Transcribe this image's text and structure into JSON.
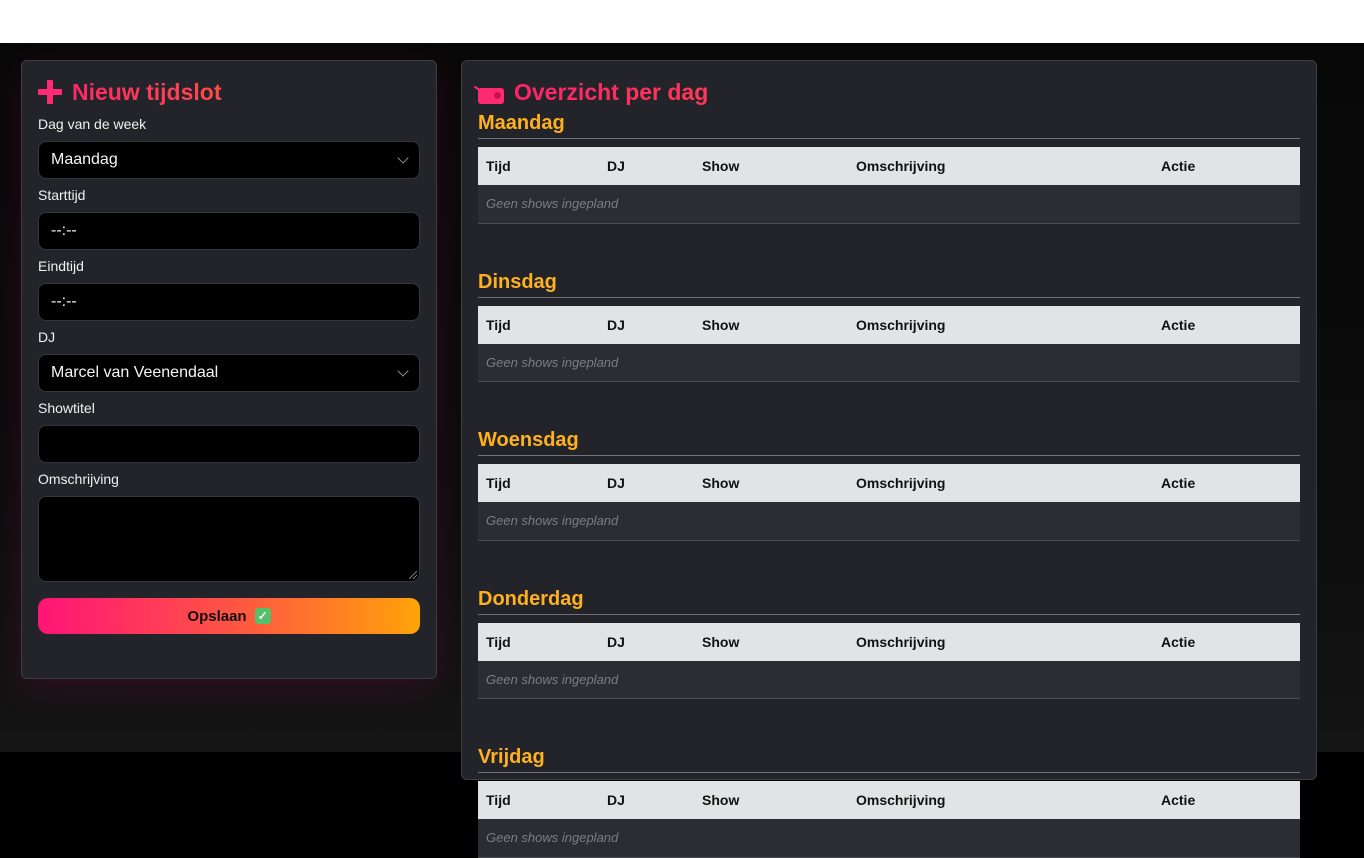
{
  "form": {
    "title": "Nieuw tijdslot",
    "fields": {
      "day": {
        "label": "Dag van de week",
        "value": "Maandag"
      },
      "start": {
        "label": "Starttijd",
        "value": "--:--"
      },
      "end": {
        "label": "Eindtijd",
        "value": "--:--"
      },
      "dj": {
        "label": "DJ",
        "value": "Marcel van Veenendaal"
      },
      "showtitle": {
        "label": "Showtitel",
        "value": ""
      },
      "description": {
        "label": "Omschrijving",
        "value": ""
      }
    },
    "save_label": "Opslaan",
    "icons": {
      "title": "plus-icon",
      "save": "check-icon"
    }
  },
  "overview": {
    "title": "Overzicht per dag",
    "icon": "radio-icon",
    "columns": [
      "Tijd",
      "DJ",
      "Show",
      "Omschrijving",
      "Actie"
    ],
    "empty_text": "Geen shows ingepland",
    "days": [
      {
        "name": "Maandag"
      },
      {
        "name": "Dinsdag"
      },
      {
        "name": "Woensdag"
      },
      {
        "name": "Donderdag"
      },
      {
        "name": "Vrijdag"
      }
    ]
  },
  "colors": {
    "accent_pink": "#ff1478",
    "accent_orange": "#ffa408",
    "day_title": "#ffb020",
    "panel_bg": "#222429"
  }
}
